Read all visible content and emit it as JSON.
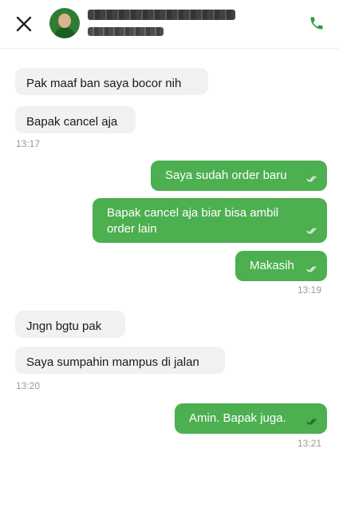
{
  "header": {
    "close_icon": "close-icon",
    "call_icon": "phone-icon",
    "accent_color": "#2e9d3a"
  },
  "messages": [
    {
      "side": "in",
      "text": "Pak maaf ban saya bocor nih"
    },
    {
      "side": "in",
      "text": "Bapak cancel aja"
    },
    {
      "side": "time",
      "text": "13:17"
    },
    {
      "side": "out",
      "text": "Saya sudah order baru"
    },
    {
      "side": "out",
      "text": "Bapak cancel aja biar bisa ambil order lain"
    },
    {
      "side": "out",
      "text": "Makasih"
    },
    {
      "side": "time",
      "text": "13:19"
    },
    {
      "side": "in",
      "text": "Jngn bgtu pak"
    },
    {
      "side": "in",
      "text": "Saya sumpahin mampus di jalan"
    },
    {
      "side": "time",
      "text": "13:20"
    },
    {
      "side": "out",
      "text": "Amin. Bapak juga."
    },
    {
      "side": "time",
      "text": "13:21"
    }
  ],
  "colors": {
    "outgoing_bubble": "#4caf50",
    "incoming_bubble": "#f1f1f1",
    "timestamp": "#9a9a9a"
  }
}
